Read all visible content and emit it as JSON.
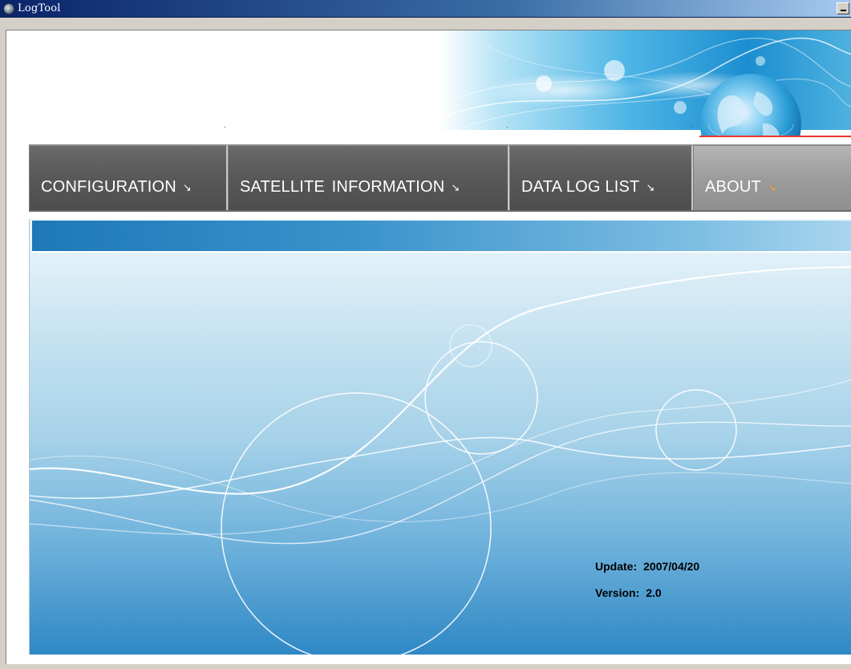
{
  "window": {
    "title": "LogTool"
  },
  "nav": {
    "items": [
      {
        "label": "CONFIGURATION",
        "active": false
      },
      {
        "label": "SATELLITE  INFORMATION",
        "active": false
      },
      {
        "label": "DATA LOG LIST",
        "active": false
      },
      {
        "label": "ABOUT",
        "active": true
      }
    ],
    "arrow_icon": "corner-arrow-icon"
  },
  "about": {
    "update_label": "Update:",
    "update_value": "2007/04/20",
    "version_label": "Version:",
    "version_value": "2.0"
  },
  "colors": {
    "titlebar": "#0a246a",
    "nav_background": "#5b5b5b",
    "nav_active": "#9c9c9c",
    "accent_red": "#e8362a",
    "panel_blue": "#2f88c5"
  }
}
